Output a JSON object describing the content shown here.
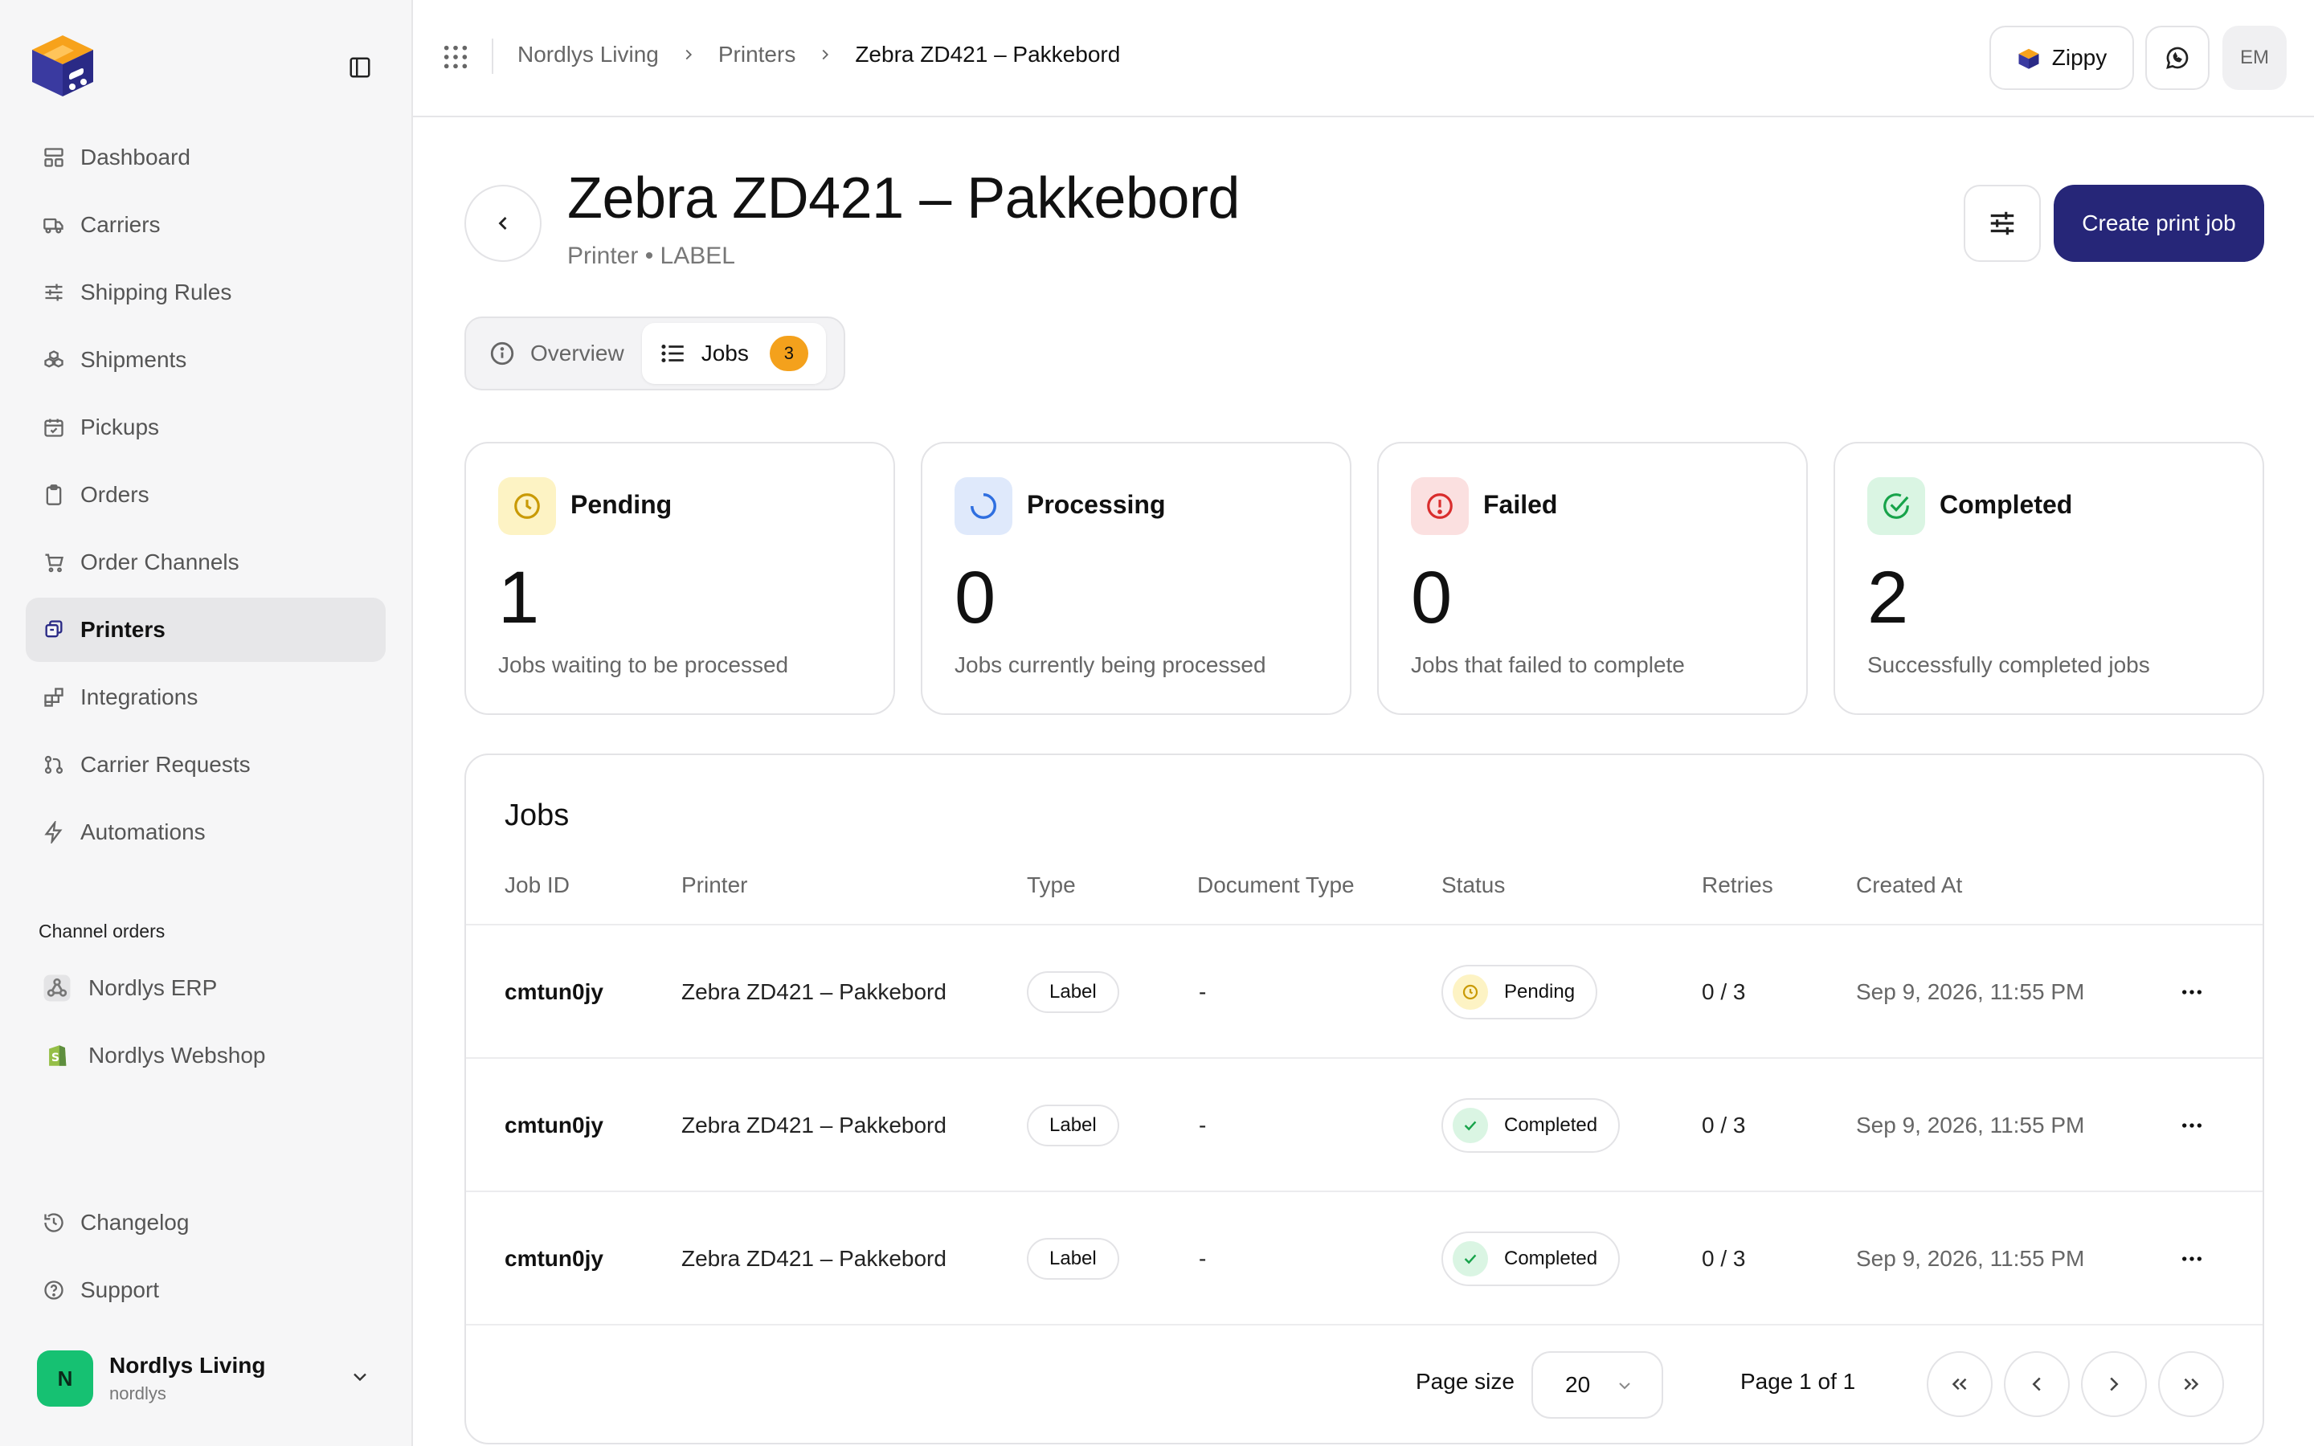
{
  "sidebar": {
    "nav": [
      {
        "label": "Dashboard",
        "icon": "dashboard-icon"
      },
      {
        "label": "Carriers",
        "icon": "truck-icon"
      },
      {
        "label": "Shipping Rules",
        "icon": "sliders-icon"
      },
      {
        "label": "Shipments",
        "icon": "boxes-icon"
      },
      {
        "label": "Pickups",
        "icon": "calendar-check-icon"
      },
      {
        "label": "Orders",
        "icon": "clipboard-icon"
      },
      {
        "label": "Order Channels",
        "icon": "cart-icon"
      },
      {
        "label": "Printers",
        "icon": "printer-icon",
        "active": true
      },
      {
        "label": "Integrations",
        "icon": "blocks-icon"
      },
      {
        "label": "Carrier Requests",
        "icon": "git-pull-icon"
      },
      {
        "label": "Automations",
        "icon": "zap-icon"
      }
    ],
    "section_label": "Channel orders",
    "channels": [
      {
        "label": "Nordlys ERP",
        "icon": "webhook-icon"
      },
      {
        "label": "Nordlys Webshop",
        "icon": "shopify-icon"
      }
    ],
    "bottom": [
      {
        "label": "Changelog",
        "icon": "history-icon"
      },
      {
        "label": "Support",
        "icon": "help-icon"
      }
    ],
    "org": {
      "initial": "N",
      "name": "Nordlys Living",
      "handle": "nordlys"
    }
  },
  "topbar": {
    "breadcrumb": [
      "Nordlys Living",
      "Printers",
      "Zebra ZD421 – Pakkebord"
    ],
    "assistant_label": "Zippy",
    "user_initials": "EM"
  },
  "header": {
    "title": "Zebra ZD421 – Pakkebord",
    "subtitle": "Printer • LABEL",
    "create_label": "Create print job"
  },
  "tabs": [
    {
      "label": "Overview"
    },
    {
      "label": "Jobs",
      "badge": "3",
      "active": true
    }
  ],
  "stats": [
    {
      "label": "Pending",
      "value": "1",
      "desc": "Jobs waiting to be processed",
      "color": "#c99a06",
      "bg": "#fdf3c4"
    },
    {
      "label": "Processing",
      "value": "0",
      "desc": "Jobs currently being processed",
      "color": "#2f6fe0",
      "bg": "#dfe9fb"
    },
    {
      "label": "Failed",
      "value": "0",
      "desc": "Jobs that failed to complete",
      "color": "#d92d2d",
      "bg": "#fbe0e0"
    },
    {
      "label": "Completed",
      "value": "2",
      "desc": "Successfully completed jobs",
      "color": "#17a34a",
      "bg": "#daf5e3"
    }
  ],
  "jobs": {
    "title": "Jobs",
    "columns": [
      "Job ID",
      "Printer",
      "Type",
      "Document Type",
      "Status",
      "Retries",
      "Created At"
    ],
    "rows": [
      {
        "id": "cmtun0jy",
        "printer": "Zebra ZD421 – Pakkebord",
        "type": "Label",
        "doc_type": "-",
        "status": "Pending",
        "retries": "0 / 3",
        "created": "Sep 9, 2026, 11:55 PM"
      },
      {
        "id": "cmtun0jy",
        "printer": "Zebra ZD421 – Pakkebord",
        "type": "Label",
        "doc_type": "-",
        "status": "Completed",
        "retries": "0 / 3",
        "created": "Sep 9, 2026, 11:55 PM"
      },
      {
        "id": "cmtun0jy",
        "printer": "Zebra ZD421 – Pakkebord",
        "type": "Label",
        "doc_type": "-",
        "status": "Completed",
        "retries": "0 / 3",
        "created": "Sep 9, 2026, 11:55 PM"
      }
    ]
  },
  "pagination": {
    "page_size_label": "Page size",
    "page_size": "20",
    "page_info": "Page 1 of 1"
  },
  "colors": {
    "primary": "#262678",
    "badge": "#f4a11c",
    "org_avatar": "#16c172"
  }
}
